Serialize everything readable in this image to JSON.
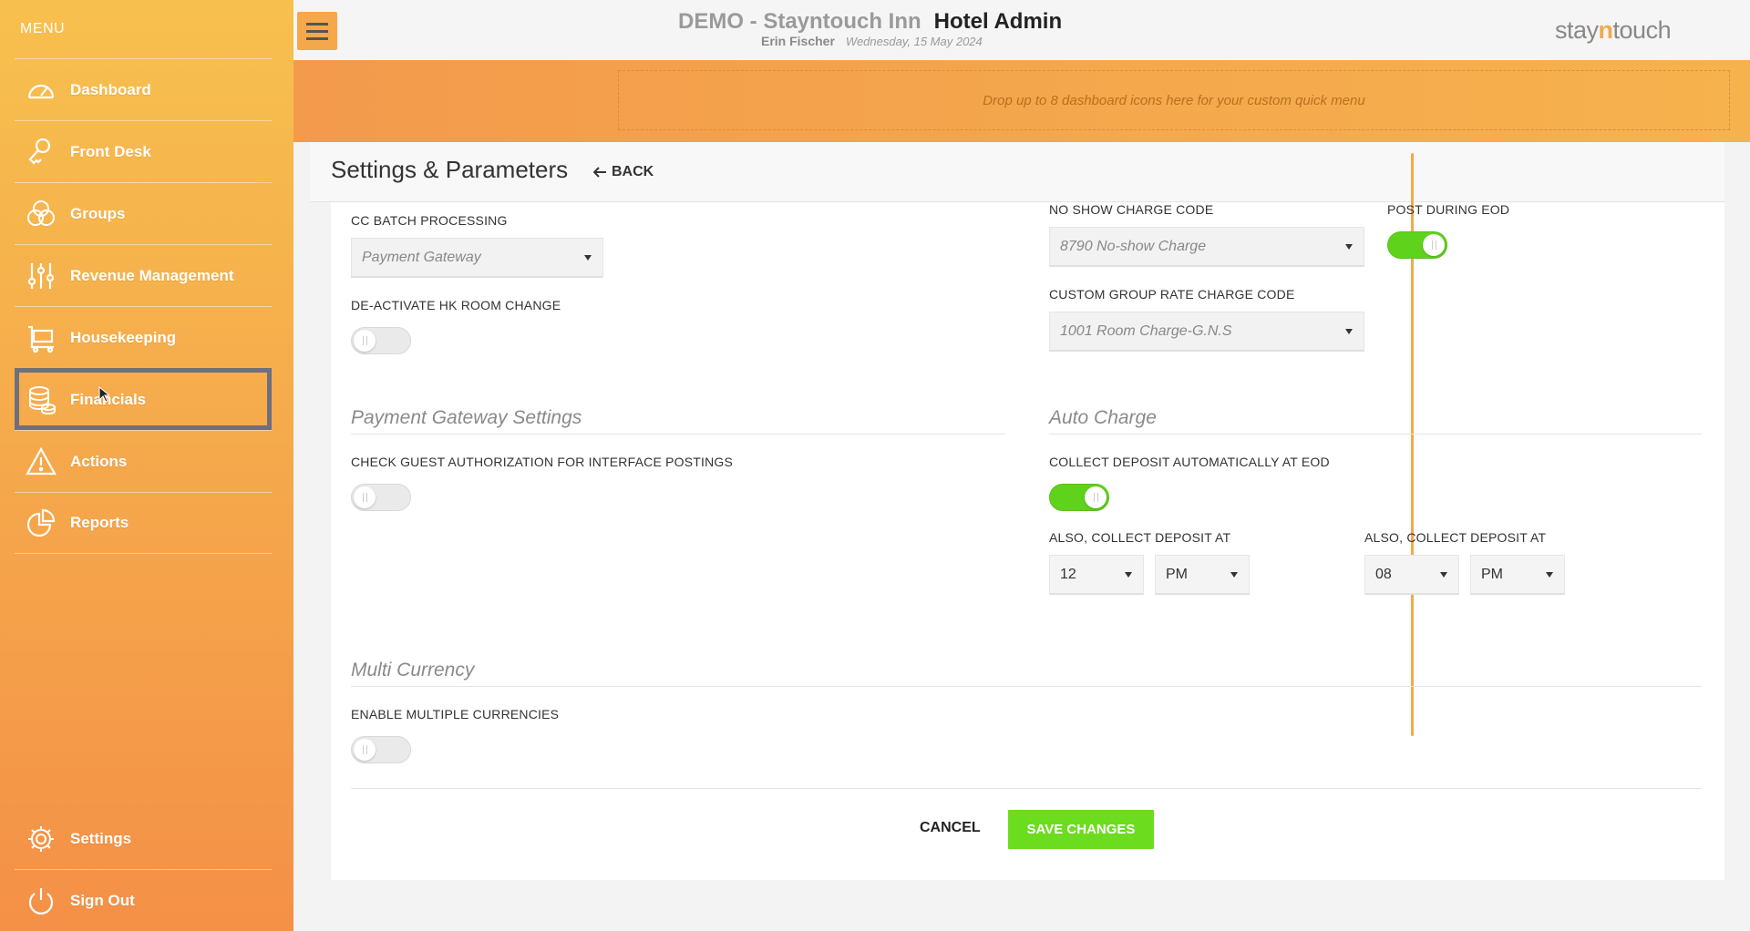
{
  "sidebar": {
    "menu_label": "MENU",
    "items": [
      {
        "label": "Dashboard",
        "icon": "gauge-icon"
      },
      {
        "label": "Front Desk",
        "icon": "key-icon"
      },
      {
        "label": "Groups",
        "icon": "circles-icon"
      },
      {
        "label": "Revenue Management",
        "icon": "sliders-icon"
      },
      {
        "label": "Housekeeping",
        "icon": "cart-icon"
      },
      {
        "label": "Financials",
        "icon": "coins-icon"
      },
      {
        "label": "Actions",
        "icon": "warning-icon"
      },
      {
        "label": "Reports",
        "icon": "pie-chart-icon"
      }
    ],
    "bottom_items": [
      {
        "label": "Settings",
        "icon": "gear-icon"
      },
      {
        "label": "Sign Out",
        "icon": "power-icon"
      }
    ]
  },
  "header": {
    "hotel_name": "DEMO - Stayntouch Inn",
    "app_title": "Hotel Admin",
    "user_name": "Erin Fischer",
    "date": "Wednesday, 15 May 2024",
    "brand_prefix": "stay",
    "brand_n": "n",
    "brand_suffix": "touch"
  },
  "quick_menu": {
    "placeholder": "Drop up to 8 dashboard icons here for your custom quick menu"
  },
  "page": {
    "title": "Settings & Parameters",
    "back_label": "BACK"
  },
  "form": {
    "cc_batch_label": "CC BATCH PROCESSING",
    "cc_batch_value": "Payment Gateway",
    "deactivate_hk_label": "DE-ACTIVATE HK ROOM CHANGE",
    "deactivate_hk_on": false,
    "no_show_label": "NO SHOW CHARGE CODE",
    "no_show_value": "8790 No-show Charge",
    "post_eod_label": "POST DURING EOD",
    "post_eod_on": true,
    "custom_group_label": "CUSTOM GROUP RATE CHARGE CODE",
    "custom_group_value": "1001 Room Charge-G.N.S",
    "pg_section": "Payment Gateway Settings",
    "check_guest_label": "CHECK GUEST AUTHORIZATION FOR INTERFACE POSTINGS",
    "check_guest_on": false,
    "auto_charge_section": "Auto Charge",
    "collect_deposit_label": "COLLECT DEPOSIT AUTOMATICALLY AT EOD",
    "collect_deposit_on": true,
    "also_collect_1_label": "ALSO, COLLECT DEPOSIT AT",
    "also_collect_1_hour": "12",
    "also_collect_1_ampm": "PM",
    "also_collect_2_label": "ALSO, COLLECT DEPOSIT AT",
    "also_collect_2_hour": "08",
    "also_collect_2_ampm": "PM",
    "multi_currency_section": "Multi Currency",
    "enable_multi_label": "ENABLE MULTIPLE CURRENCIES",
    "enable_multi_on": false
  },
  "actions": {
    "cancel_label": "CANCEL",
    "save_label": "SAVE CHANGES"
  },
  "colors": {
    "accent_orange": "#f5a84b",
    "toggle_on": "#5fd31b",
    "save_green": "#6cdc1e"
  }
}
